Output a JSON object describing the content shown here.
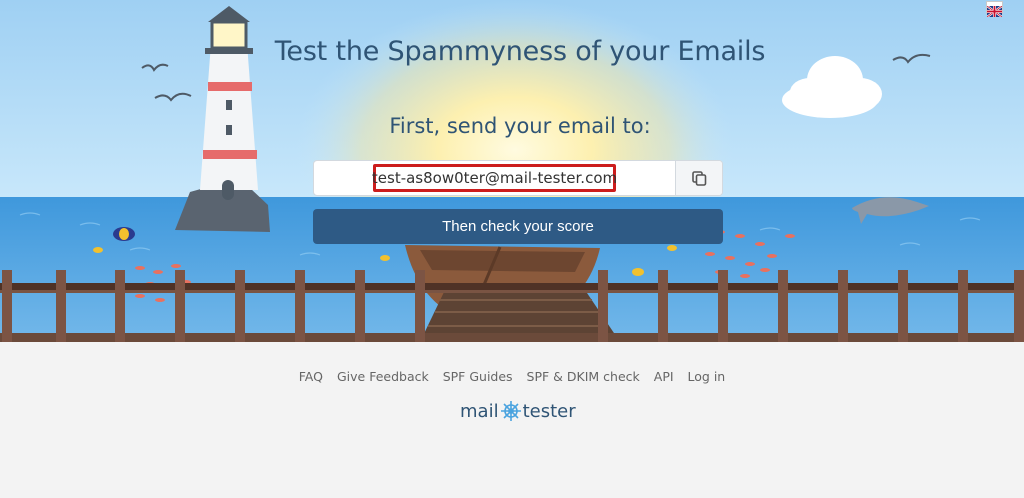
{
  "hero": {
    "title": "Test the Spammyness of your Emails",
    "subtitle": "First, send your email to:",
    "email_address": "test-as8ow0ter@mail-tester.com",
    "check_button_label": "Then check your score"
  },
  "footer": {
    "links": [
      "FAQ",
      "Give Feedback",
      "SPF Guides",
      "SPF & DKIM check",
      "API",
      "Log in"
    ],
    "logo_left": "mail",
    "logo_right": "tester"
  },
  "colors": {
    "sky_top": "#a8d3f2",
    "sea": "#4b9fdc",
    "title": "#2f5475",
    "button": "#2e5a85",
    "highlight_border": "#cc1d1d"
  },
  "icons": [
    "copy-icon",
    "flag-icon",
    "ship-wheel-icon"
  ]
}
